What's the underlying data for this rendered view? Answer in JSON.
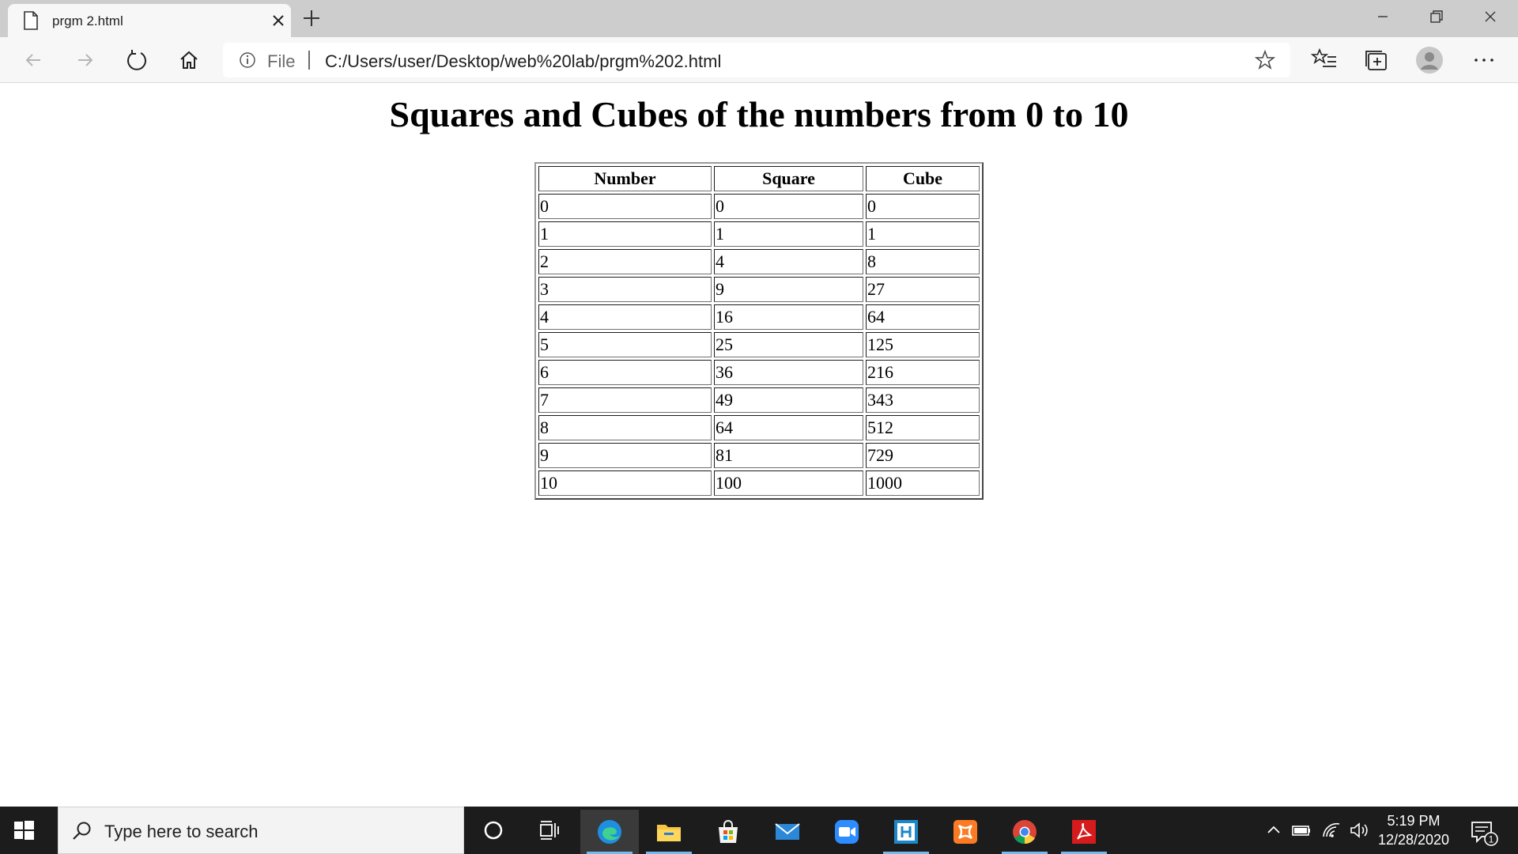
{
  "browser": {
    "tab_title": "prgm 2.html",
    "address_scheme": "File",
    "address_url": "C:/Users/user/Desktop/web%20lab/prgm%202.html"
  },
  "page": {
    "heading": "Squares and Cubes of the numbers from 0 to 10",
    "table": {
      "headers": [
        "Number",
        "Square",
        "Cube"
      ],
      "rows": [
        [
          "0",
          "0",
          "0"
        ],
        [
          "1",
          "1",
          "1"
        ],
        [
          "2",
          "4",
          "8"
        ],
        [
          "3",
          "9",
          "27"
        ],
        [
          "4",
          "16",
          "64"
        ],
        [
          "5",
          "25",
          "125"
        ],
        [
          "6",
          "36",
          "216"
        ],
        [
          "7",
          "49",
          "343"
        ],
        [
          "8",
          "64",
          "512"
        ],
        [
          "9",
          "81",
          "729"
        ],
        [
          "10",
          "100",
          "1000"
        ]
      ]
    }
  },
  "taskbar": {
    "search_placeholder": "Type here to search",
    "time": "5:19 PM",
    "date": "12/28/2020",
    "notification_count": "1",
    "apps": [
      {
        "icon": "edge-icon",
        "color": "#1f8ee0",
        "running": true,
        "active": true
      },
      {
        "icon": "file-explorer-icon",
        "color": "#f4c542",
        "running": true,
        "active": false
      },
      {
        "icon": "microsoft-store-icon",
        "color": "#f3f3f3",
        "running": false,
        "active": false
      },
      {
        "icon": "mail-icon",
        "color": "#2b88d8",
        "running": false,
        "active": false
      },
      {
        "icon": "zoom-icon",
        "color": "#2d8cff",
        "running": false,
        "active": false
      },
      {
        "icon": "code-editor-icon",
        "color": "#1e87c8",
        "running": true,
        "active": false
      },
      {
        "icon": "xampp-icon",
        "color": "#fb7a24",
        "running": false,
        "active": false
      },
      {
        "icon": "chrome-beta-icon",
        "color": "#4285f4",
        "running": true,
        "active": false
      },
      {
        "icon": "acrobat-reader-icon",
        "color": "#d51b1b",
        "running": true,
        "active": false
      }
    ]
  }
}
